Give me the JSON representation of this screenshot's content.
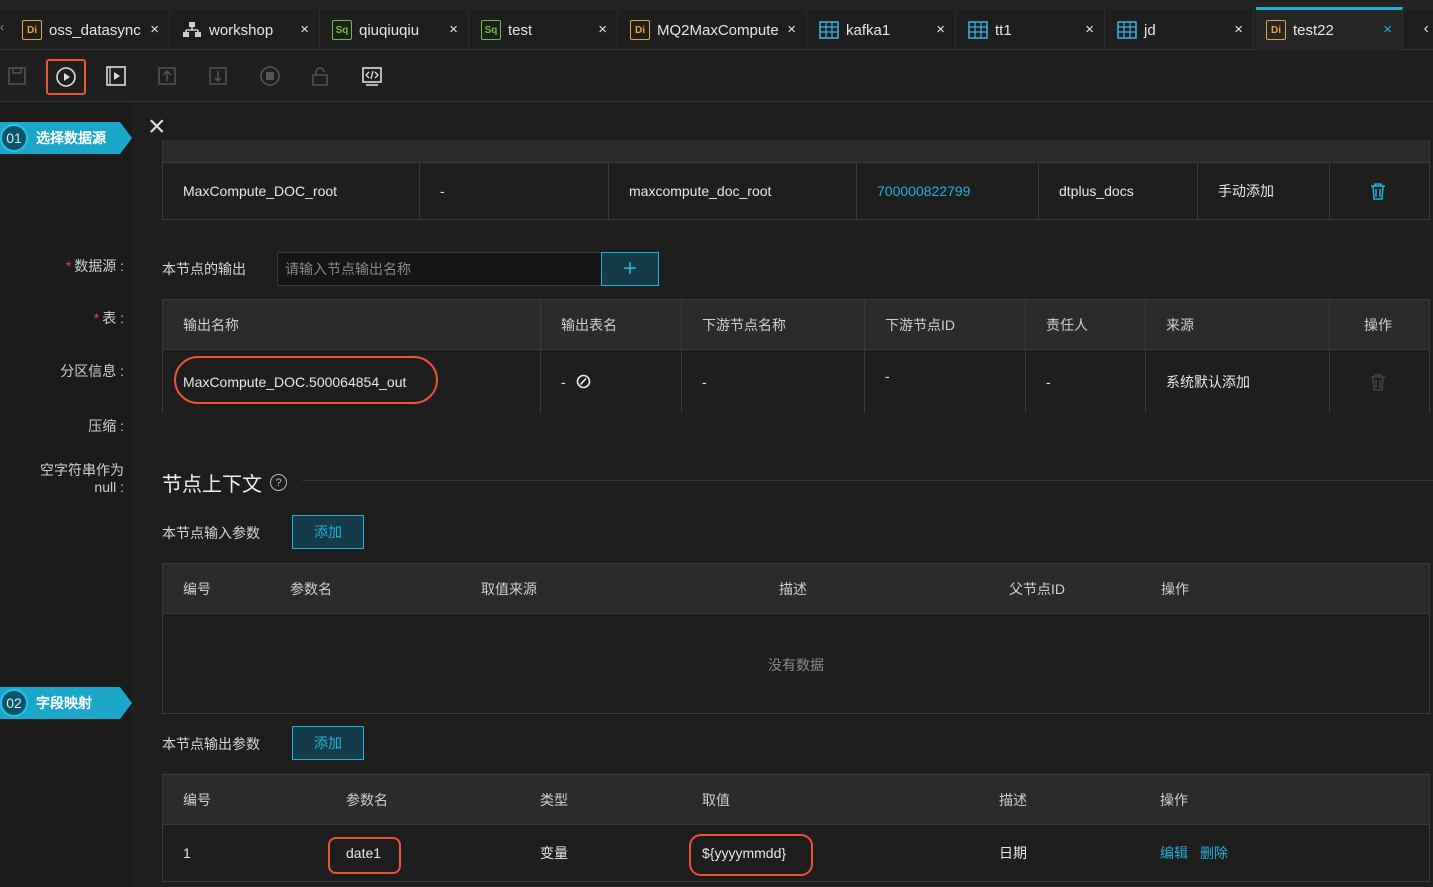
{
  "tabs": [
    {
      "label": "oss_datasync",
      "icon": "Di"
    },
    {
      "label": "workshop",
      "icon": "workflow-icon"
    },
    {
      "label": "qiuqiuqiu",
      "icon": "Sq"
    },
    {
      "label": "test",
      "icon": "Sq"
    },
    {
      "label": "MQ2MaxCompute",
      "icon": "Di"
    },
    {
      "label": "kafka1",
      "icon": "table-icon"
    },
    {
      "label": "tt1",
      "icon": "table-icon"
    },
    {
      "label": "jd",
      "icon": "table-icon"
    },
    {
      "label": "test22",
      "icon": "Di"
    }
  ],
  "close_glyph": "×",
  "steps": {
    "step1_num": "01",
    "step1_label": "选择数据源",
    "step2_num": "02",
    "step2_label": "字段映射"
  },
  "left_fields": {
    "datasource": "数据源 :",
    "table": "表 :",
    "partition": "分区信息 :",
    "compress": "压缩 :",
    "null_line1": "空字符串作为",
    "null_line2": "null :",
    "required_mark": "*"
  },
  "input_table": {
    "row": [
      "MaxCompute_DOC_root",
      "-",
      "maxcompute_doc_root",
      "700000822799",
      "dtplus_docs",
      "手动添加"
    ]
  },
  "output": {
    "label": "本节点的输出",
    "placeholder": "请输入节点输出名称",
    "plus": "+"
  },
  "output_table": {
    "headers": [
      "输出名称",
      "输出表名",
      "下游节点名称",
      "下游节点ID",
      "责任人",
      "来源",
      "操作"
    ],
    "row": [
      "MaxCompute_DOC.500064854_out",
      "-",
      "-",
      "-",
      "-",
      "系统默认添加"
    ]
  },
  "context": {
    "title": "节点上下文",
    "help": "?",
    "input_params_label": "本节点输入参数",
    "add_label": "添加",
    "input_headers": [
      "编号",
      "参数名",
      "取值来源",
      "描述",
      "父节点ID",
      "操作"
    ],
    "no_data": "没有数据",
    "output_params_label": "本节点输出参数",
    "output_headers": [
      "编号",
      "参数名",
      "类型",
      "取值",
      "描述",
      "操作"
    ],
    "output_row": {
      "num": "1",
      "name": "date1",
      "type": "变量",
      "value": "${yyyymmdd}",
      "desc": "日期",
      "edit": "编辑",
      "delete": "删除"
    }
  }
}
